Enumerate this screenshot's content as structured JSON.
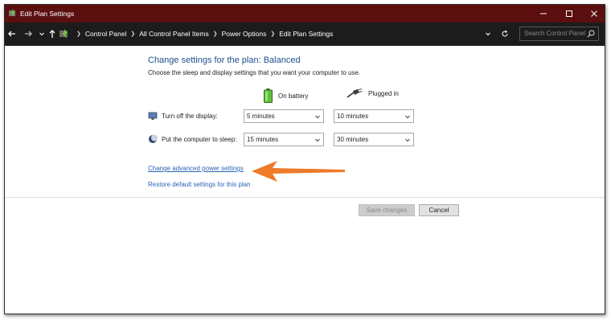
{
  "window": {
    "title": "Edit Plan Settings"
  },
  "address_bar": {
    "breadcrumbs": [
      "Control Panel",
      "All Control Panel Items",
      "Power Options",
      "Edit Plan Settings"
    ],
    "search_placeholder": "Search Control Panel"
  },
  "main": {
    "heading": "Change settings for the plan: Balanced",
    "subheading": "Choose the sleep and display settings that you want your computer to use.",
    "columns": {
      "on_battery": "On battery",
      "plugged_in": "Plugged in"
    },
    "rows": [
      {
        "label": "Turn off the display:",
        "on_battery": "5 minutes",
        "plugged_in": "10 minutes"
      },
      {
        "label": "Put the computer to sleep:",
        "on_battery": "15 minutes",
        "plugged_in": "30 minutes"
      }
    ],
    "links": {
      "advanced": "Change advanced power settings",
      "restore": "Restore default settings for this plan"
    }
  },
  "footer": {
    "save_label": "Save changes",
    "cancel_label": "Cancel"
  },
  "colors": {
    "titlebar": "#5b0f0f",
    "addressbar": "#1c1c1c",
    "heading": "#1e4f8f",
    "link": "#2c62b8",
    "annotation_arrow": "#ee7a2a"
  },
  "icons": {
    "app": "power-options-icon",
    "battery": "battery-icon",
    "plug": "plug-icon",
    "display": "monitor-icon",
    "sleep": "moon-icon"
  }
}
